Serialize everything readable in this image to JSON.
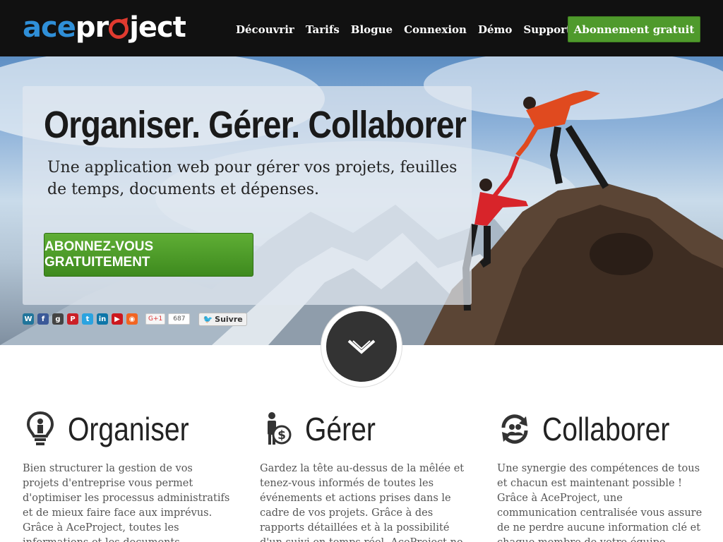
{
  "header": {
    "logo": {
      "part1": "ace",
      "part2a": "pr",
      "part2b": "ject"
    },
    "nav": [
      "Découvrir",
      "Tarifs",
      "Blogue",
      "Connexion",
      "Démo",
      "Support"
    ],
    "cta": "Abonnement gratuit"
  },
  "hero": {
    "title": "Organiser. Gérer. Collaborer",
    "subtitle": "Une application web pour gérer vos projets, feuilles de temps, documents et dépenses.",
    "button": "ABONNEZ-VOUS GRATUITEMENT"
  },
  "social": {
    "icons": [
      "wordpress-icon",
      "facebook-icon",
      "google-icon",
      "pinterest-icon",
      "twitter-icon",
      "linkedin-icon",
      "youtube-icon",
      "rss-icon"
    ],
    "gplus_label": "G+1",
    "gplus_count": "687",
    "follow_label": "Suivre"
  },
  "features": [
    {
      "title": "Organiser",
      "icon": "lightbulb-person-icon",
      "text": "Bien structurer la gestion de vos projets d'entreprise vous permet d'optimiser les processus administratifs et de mieux faire face aux imprévus. Grâce à AceProject, toutes les informations et les documents pertinents pour vos"
    },
    {
      "title": "Gérer",
      "icon": "person-dollar-icon",
      "text": "Gardez la tête au-dessus de la mêlée et tenez-vous informés de toutes les événements et actions prises dans le cadre de vos projets. Grâce à des rapports détaillées et à la possibilité d'un suivi en temps réel, AceProject ne"
    },
    {
      "title": "Collaborer",
      "icon": "people-cycle-icon",
      "text": "Une synergie des compétences de tous et chacun est maintenant possible ! Grâce à AceProject, une communication centralisée vous assure de ne perdre aucune information clé et chaque membre de votre équipe dispose d'un"
    }
  ],
  "colors": {
    "topbar": "#111111",
    "accent_green": "#4f9a2c",
    "logo_blue": "#2f8fd8",
    "logo_red": "#e03a2f"
  }
}
